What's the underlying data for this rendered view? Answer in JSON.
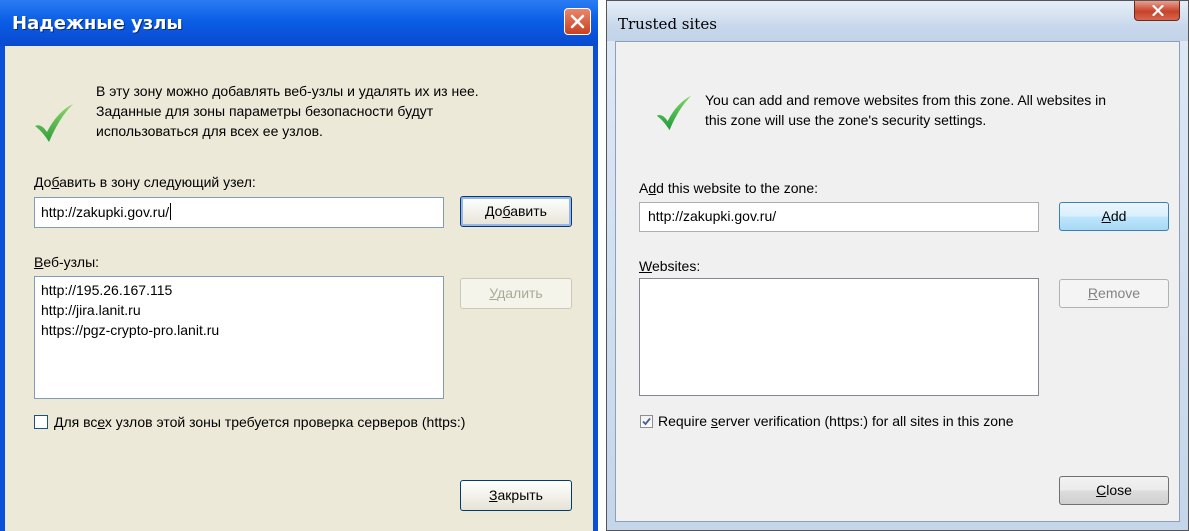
{
  "xp_dialog": {
    "title": "Надежные узлы",
    "description_lines": [
      "В эту зону можно добавлять веб-узлы и удалять их из нее.",
      "Заданные для зоны параметры безопасности будут",
      "использоваться для всех ее узлов."
    ],
    "add_label": {
      "before": "До",
      "mnemonic": "б",
      "after": "авить в зону следующий узел:"
    },
    "url_value": "http://zakupki.gov.ru/",
    "add_button": {
      "before": "До",
      "mnemonic": "б",
      "after": "авить"
    },
    "websites_label": {
      "before": "",
      "mnemonic": "В",
      "after": "еб-узлы:"
    },
    "websites": [
      "http://195.26.167.115",
      "http://jira.lanit.ru",
      "https://pgz-crypto-pro.lanit.ru"
    ],
    "remove_button": {
      "before": "",
      "mnemonic": "У",
      "after": "далить"
    },
    "require_https": {
      "before": "Для вс",
      "mnemonic": "е",
      "after": "х узлов этой зоны требуется проверка серверов (https:)",
      "checked": false
    },
    "close_button": {
      "before": "",
      "mnemonic": "З",
      "after": "акрыть"
    }
  },
  "win7_dialog": {
    "title": "Trusted sites",
    "description_lines": [
      "You can add and remove websites from this zone. All websites in",
      "this zone will use the zone's security settings."
    ],
    "add_label": {
      "before": "A",
      "mnemonic": "d",
      "after": "d this website to the zone:"
    },
    "url_value": "http://zakupki.gov.ru/",
    "add_button": {
      "before": "",
      "mnemonic": "A",
      "after": "dd"
    },
    "websites_label": {
      "before": "",
      "mnemonic": "W",
      "after": "ebsites:"
    },
    "websites": [],
    "remove_button": {
      "before": "",
      "mnemonic": "R",
      "after": "emove"
    },
    "require_https": {
      "before": "Require ",
      "mnemonic": "s",
      "after": "erver verification (https:) for all sites in this zone",
      "checked": true
    },
    "close_button": {
      "before": "",
      "mnemonic": "C",
      "after": "lose"
    }
  },
  "colors": {
    "xp_title": "#0b5ee6",
    "check_green": "#3aa83a",
    "win7_title": "#c9d8ec"
  }
}
